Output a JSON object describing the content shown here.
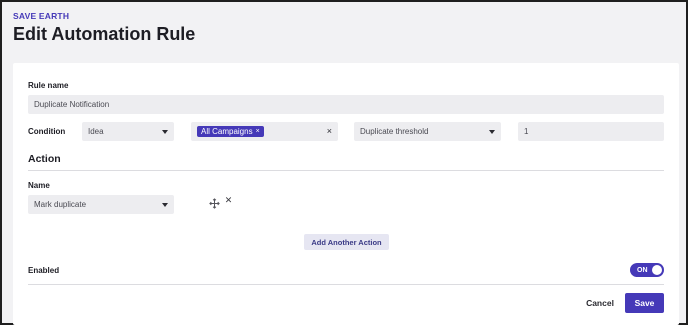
{
  "header": {
    "eyebrow": "SAVE EARTH",
    "title": "Edit Automation Rule"
  },
  "rule": {
    "name_label": "Rule name",
    "name_value": "Duplicate Notification",
    "condition_label": "Condition",
    "condition_type": "Idea",
    "campaign_chip": "All Campaigns",
    "chip_remove": "×",
    "clear_symbol": "×",
    "condition_metric": "Duplicate threshold",
    "condition_value": "1"
  },
  "action": {
    "section_title": "Action",
    "name_label": "Name",
    "name_value": "Mark duplicate",
    "remove_symbol": "✕",
    "add_label": "Add Another Action"
  },
  "enabled": {
    "label": "Enabled",
    "toggle_text": "ON",
    "state": true
  },
  "footer": {
    "cancel_label": "Cancel",
    "save_label": "Save"
  },
  "icons": {
    "move": "move-icon",
    "remove": "close-icon",
    "dropdown": "chevron-down-icon"
  },
  "colors": {
    "accent": "#4539b8",
    "field_bg": "#ededf0",
    "page_bg": "#f2f2f4"
  }
}
